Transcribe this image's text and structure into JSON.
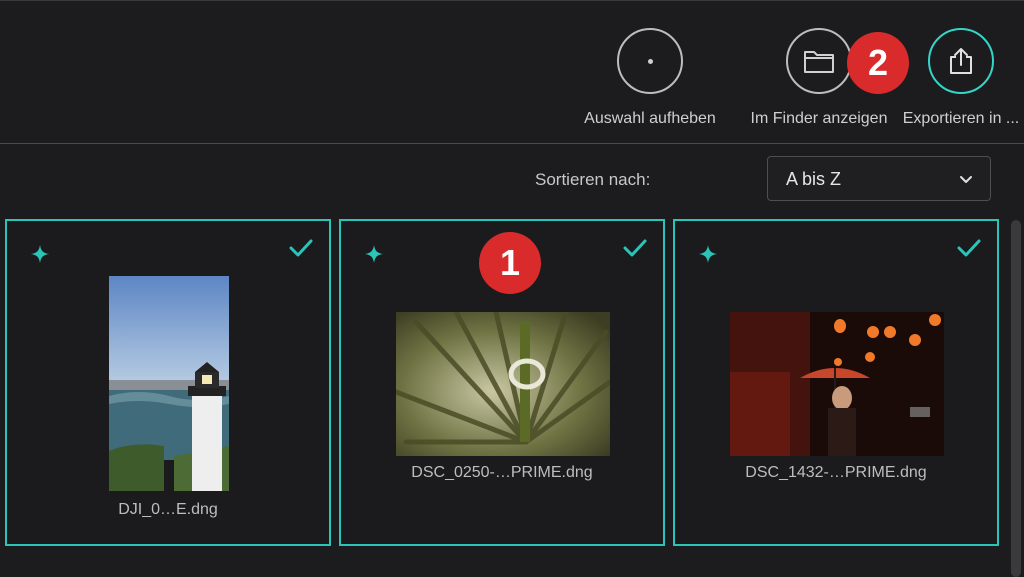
{
  "toolbar": {
    "deselect_label": "Auswahl aufheben",
    "finder_label": "Im Finder anzeigen",
    "export_label": "Exportieren in ..."
  },
  "sort": {
    "label": "Sortieren nach:",
    "value": "A bis Z"
  },
  "callouts": [
    "1",
    "2"
  ],
  "photos": [
    {
      "filename": "DJI_0…E.dng",
      "selected": true
    },
    {
      "filename": "DSC_0250-…PRIME.dng",
      "selected": true
    },
    {
      "filename": "DSC_1432-…PRIME.dng",
      "selected": true
    }
  ],
  "colors": {
    "accent": "#2bc4b8",
    "badge": "#d92b2b",
    "background": "#1c1c1e"
  },
  "icons": [
    "dot-icon",
    "folder-icon",
    "share-icon",
    "sparkle-icon",
    "checkmark-icon",
    "chevron-down-icon"
  ]
}
